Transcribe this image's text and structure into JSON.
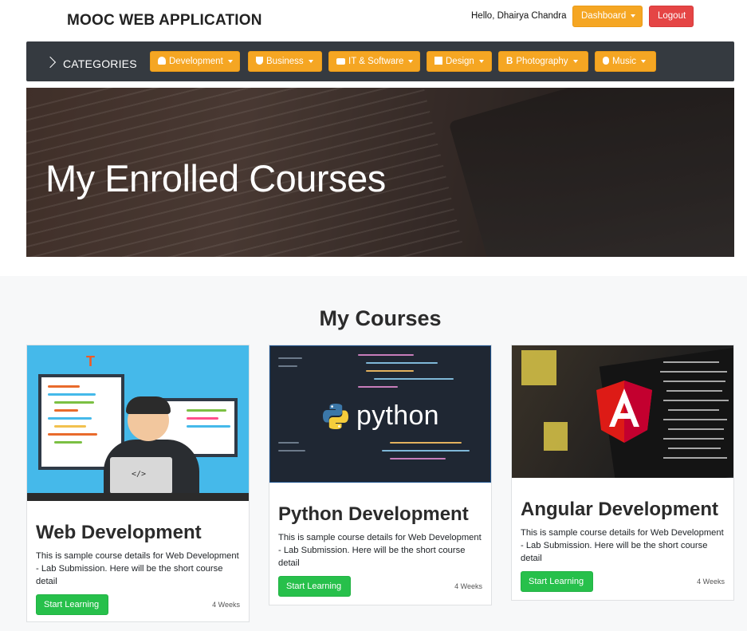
{
  "header": {
    "brand": "MOOC WEB APPLICATION",
    "greeting": "Hello, Dhairya Chandra",
    "dashboard_label": "Dashboard",
    "logout_label": "Logout"
  },
  "categories": {
    "label": "CATEGORIES",
    "items": [
      {
        "label": "Development",
        "icon": "headphones-icon"
      },
      {
        "label": "Business",
        "icon": "magnet-icon"
      },
      {
        "label": "IT & Software",
        "icon": "hdd-icon"
      },
      {
        "label": "Design",
        "icon": "stop-icon"
      },
      {
        "label": "Photography",
        "icon": "bold-icon"
      },
      {
        "label": "Music",
        "icon": "apple-icon"
      }
    ]
  },
  "hero": {
    "title": "My Enrolled Courses"
  },
  "courses": {
    "title": "My Courses",
    "items": [
      {
        "title": "Web Development",
        "description": "This is sample course details for Web Development - Lab Submission. Here will be the short course detail",
        "button": "Start Learning",
        "duration": "4 Weeks",
        "image": "web-development-illustration"
      },
      {
        "title": "Python Development",
        "description": "This is sample course details for Web Development - Lab Submission. Here will be the short course detail",
        "button": "Start Learning",
        "duration": "4 Weeks",
        "image": "python-logo-image",
        "image_text": "python"
      },
      {
        "title": "Angular Development",
        "description": "This is sample course details for Web Development - Lab Submission. Here will be the short course detail",
        "button": "Start Learning",
        "duration": "4 Weeks",
        "image": "angular-logo-image"
      }
    ]
  },
  "colors": {
    "accent": "#f5a623",
    "danger": "#e54545",
    "success": "#27c04b",
    "navbar": "#353a40"
  }
}
